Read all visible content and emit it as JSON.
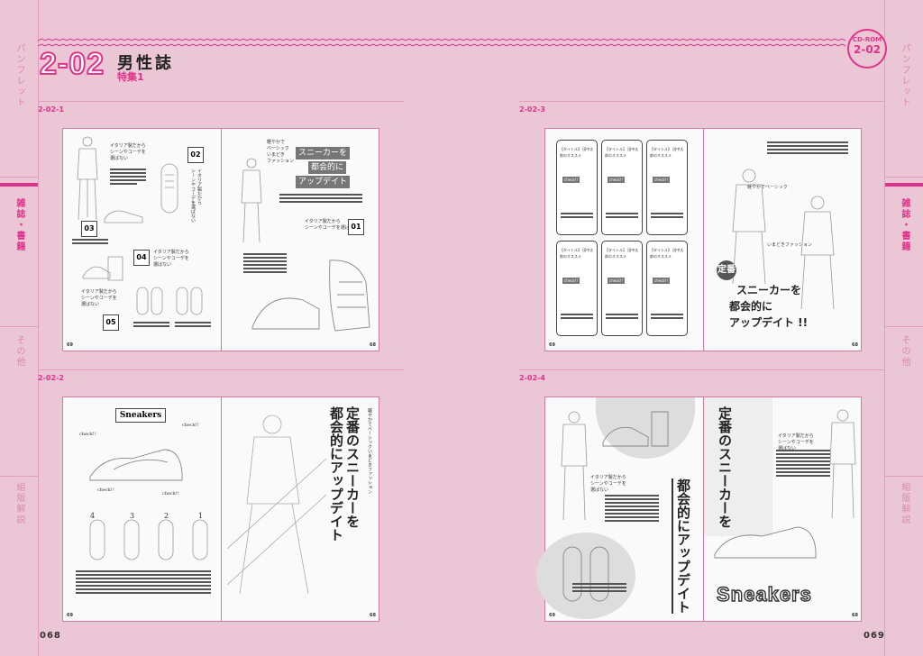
{
  "side_left": {
    "tabs": [
      "パンフレット",
      "雑誌・書籍",
      "その他",
      "組版解説"
    ]
  },
  "side_right": {
    "tabs": [
      "パンフレット",
      "雑誌・書籍",
      "その他",
      "組版解説"
    ]
  },
  "header": {
    "code": "2-02",
    "title": "男性誌",
    "subtitle": "特集1",
    "cdrom_label": "CD-ROM",
    "cdrom_code": "2-02"
  },
  "sections": [
    {
      "label": "2-02-1"
    },
    {
      "label": "2-02-3"
    },
    {
      "label": "2-02-2"
    },
    {
      "label": "2-02-4"
    }
  ],
  "spread1": {
    "badges": [
      "02",
      "03",
      "04",
      "05",
      "01"
    ],
    "caption": "イタリア製だから\nシーンやコーデを\n選ばない",
    "heading_lines": [
      "スニーカーを",
      "都会的に",
      "アップデイト"
    ],
    "lead": "軽やかで\nベーシック\nいまどき\nファッション",
    "folio_left": "69",
    "folio_right": "68"
  },
  "spread3": {
    "card_title": "【タイトル】\n田中太郎のオススメ",
    "check": "check!!",
    "side_note1": "軽やかでベーシック",
    "side_note2": "いまどきファッション",
    "stamp": "定番",
    "heading_lines": [
      "スニーカーを",
      "都会的に",
      "アップデイト !!"
    ],
    "folio_left": "69",
    "folio_right": "68"
  },
  "spread2": {
    "sign": "Sneakers",
    "check": "check!!",
    "numbers": [
      "4",
      "3",
      "2",
      "1"
    ],
    "vertical_heading": [
      "定番のスニーカーを",
      "都会的にアップデイト"
    ],
    "vertical_lead": "軽やかでベーシックいまどきファッション",
    "folio_left": "69",
    "folio_right": "68"
  },
  "spread4": {
    "vertical_left": "都会的にアップデイト",
    "vertical_right": "定番のスニーカーを",
    "caption": "イタリア製だから\nシーンやコーデを\n選ばない",
    "sneakers_word": "Sneakers",
    "folio_left": "69",
    "folio_right": "68"
  },
  "footer": {
    "page_left": "068",
    "page_right": "069"
  },
  "colors": {
    "background": "#ebc6d4",
    "accent": "#e0338b",
    "page": "#fafafa"
  }
}
